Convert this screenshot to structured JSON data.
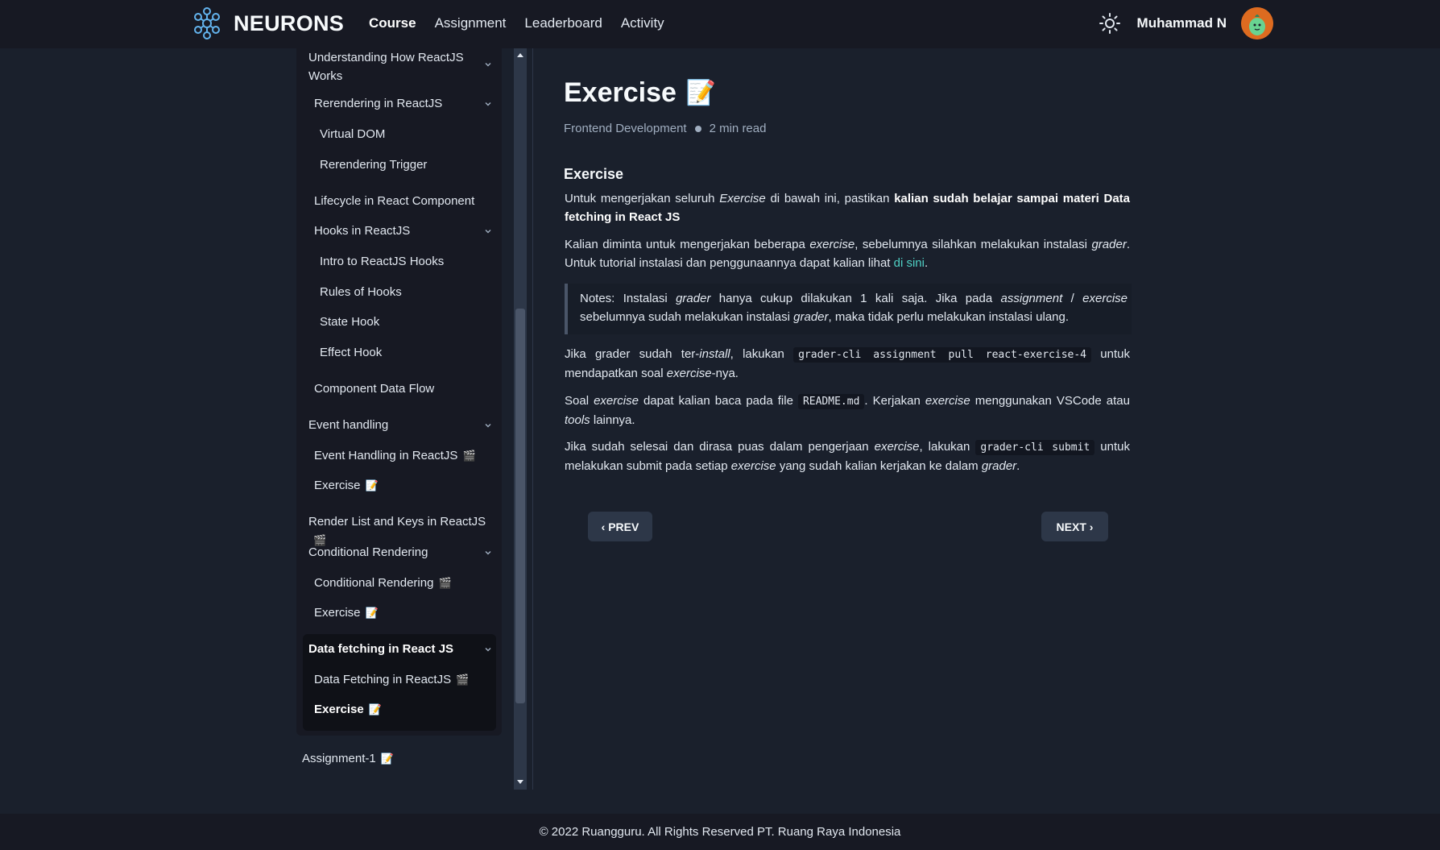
{
  "header": {
    "brand": "NEURONS",
    "nav": [
      {
        "label": "Course",
        "active": true
      },
      {
        "label": "Assignment",
        "active": false
      },
      {
        "label": "Leaderboard",
        "active": false
      },
      {
        "label": "Activity",
        "active": false
      }
    ],
    "username": "Muhammad N",
    "theme_icon": "sun-icon"
  },
  "sidebar": {
    "items": [
      {
        "label": "Understanding How ReactJS",
        "label2": "Works",
        "level": 0,
        "chevron": true
      },
      {
        "label": "Rerendering in ReactJS",
        "level": 1,
        "chevron": true
      },
      {
        "label": "Virtual DOM",
        "level": 2
      },
      {
        "label": "Rerendering Trigger",
        "level": 2
      },
      {
        "label": "Lifecycle in React Component",
        "level": 1
      },
      {
        "label": "Hooks in ReactJS",
        "level": 1,
        "chevron": true
      },
      {
        "label": "Intro to ReactJS Hooks",
        "level": 2
      },
      {
        "label": "Rules of Hooks",
        "level": 2
      },
      {
        "label": "State Hook",
        "level": 2
      },
      {
        "label": "Effect Hook",
        "level": 2
      },
      {
        "label": "Component Data Flow",
        "level": 1
      },
      {
        "label": "Event handling",
        "level": 0,
        "chevron": true
      },
      {
        "label": "Event Handling in ReactJS",
        "level": 1,
        "emoji": "🎬"
      },
      {
        "label": "Exercise",
        "level": 1,
        "emoji": "📝"
      },
      {
        "label": "Render List and Keys in ReactJS",
        "level": 0,
        "emoji": "🎬"
      },
      {
        "label": "Conditional Rendering",
        "level": 0,
        "chevron": true
      },
      {
        "label": "Conditional Rendering",
        "level": 1,
        "emoji": "🎬"
      },
      {
        "label": "Exercise",
        "level": 1,
        "emoji": "📝"
      },
      {
        "label": "Data fetching in React JS",
        "level": 0,
        "chevron": true,
        "bold": true
      },
      {
        "label": "Data Fetching in ReactJS",
        "level": 1,
        "emoji": "🎬"
      },
      {
        "label": "Exercise",
        "level": 1,
        "emoji": "📝",
        "bold": true
      },
      {
        "label": "Assignment-1",
        "level": -1,
        "emoji": "📝"
      }
    ]
  },
  "main": {
    "title": "Exercise",
    "title_emoji": "📝",
    "meta_category": "Frontend Development",
    "meta_read": "2 min read",
    "section_title": "Exercise",
    "p1_a": "Untuk mengerjakan seluruh ",
    "p1_i": "Exercise",
    "p1_b": " di bawah ini, pastikan ",
    "p1_bold": "kalian sudah belajar sampai materi Data fetching in React JS",
    "p2_a": "Kalian diminta untuk mengerjakan beberapa ",
    "p2_i1": "exercise",
    "p2_b": ", sebelumnya silahkan melakukan instalasi ",
    "p2_i2": "grader",
    "p2_c": ". Untuk tutorial instalasi dan penggunaannya dapat kalian lihat ",
    "p2_link": "di sini",
    "p2_d": ".",
    "q_a": "Notes: Instalasi ",
    "q_i1": "grader",
    "q_b": " hanya cukup dilakukan 1 kali saja. Jika pada ",
    "q_i2": "assignment",
    "q_c": " / ",
    "q_i3": "exercise",
    "q_d": " sebelumnya sudah melakukan instalasi ",
    "q_i4": "grader",
    "q_e": ", maka tidak perlu melakukan instalasi ulang.",
    "p3_a": "Jika grader sudah ter-",
    "p3_i1": "install",
    "p3_b": ", lakukan ",
    "p3_code": "grader-cli assignment pull react-exercise-4",
    "p3_c": " untuk mendapatkan soal ",
    "p3_i2": "exercise",
    "p3_d": "-nya.",
    "p4_a": "Soal ",
    "p4_i1": "exercise",
    "p4_b": " dapat kalian baca pada file ",
    "p4_code": "README.md",
    "p4_c": ". Kerjakan ",
    "p4_i2": "exercise",
    "p4_d": " menggunakan VSCode atau ",
    "p4_i3": "tools",
    "p4_e": " lainnya.",
    "p5_a": "Jika sudah selesai dan dirasa puas dalam pengerjaan ",
    "p5_i1": "exercise",
    "p5_b": ", lakukan ",
    "p5_code": "grader-cli submit",
    "p5_c": " untuk melakukan submit pada setiap ",
    "p5_i2": "exercise",
    "p5_d": " yang sudah kalian kerjakan ke dalam ",
    "p5_i3": "grader",
    "p5_e": ".",
    "prev_label": "‹ PREV",
    "next_label": "NEXT ›"
  },
  "footer": {
    "text": "© 2022 Ruangguru. All Rights Reserved PT. Ruang Raya Indonesia"
  }
}
